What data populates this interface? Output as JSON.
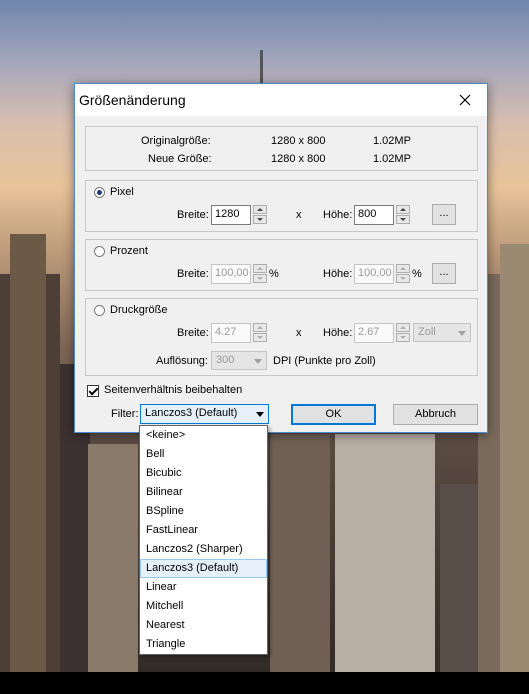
{
  "dialog": {
    "title": "Größenänderung",
    "info": {
      "original_label": "Originalgröße:",
      "original_dims": "1280 x 800",
      "original_mp": "1.02MP",
      "new_label": "Neue Größe:",
      "new_dims": "1280 x 800",
      "new_mp": "1.02MP"
    },
    "pixel": {
      "label": "Pixel",
      "width_label": "Breite:",
      "width_value": "1280",
      "x_label": "x",
      "height_label": "Höhe:",
      "height_value": "800",
      "more_button": "..."
    },
    "percent": {
      "label": "Prozent",
      "width_label": "Breite:",
      "width_value": "100,00",
      "width_unit": "%",
      "height_label": "Höhe:",
      "height_value": "100,00",
      "height_unit": "%",
      "more_button": "..."
    },
    "print": {
      "label": "Druckgröße",
      "width_label": "Breite:",
      "width_value": "4.27",
      "x_label": "x",
      "height_label": "Höhe:",
      "height_value": "2.67",
      "unit_select": "Zoll",
      "resolution_label": "Auflösung:",
      "resolution_value": "300",
      "resolution_unit": "DPI (Punkte pro Zoll)"
    },
    "keep_ratio_label": "Seitenverhältnis beibehalten",
    "filter_label": "Filter:",
    "filter_value": "Lanczos3 (Default)",
    "ok_button": "OK",
    "cancel_button": "Abbruch"
  },
  "filter_options": [
    "<keine>",
    "Bell",
    "Bicubic",
    "Bilinear",
    "BSpline",
    "FastLinear",
    "Lanczos2 (Sharper)",
    "Lanczos3 (Default)",
    "Linear",
    "Mitchell",
    "Nearest",
    "Triangle"
  ],
  "colors": {
    "accent": "#0078d7",
    "selected_item": "#e5f0fb"
  }
}
